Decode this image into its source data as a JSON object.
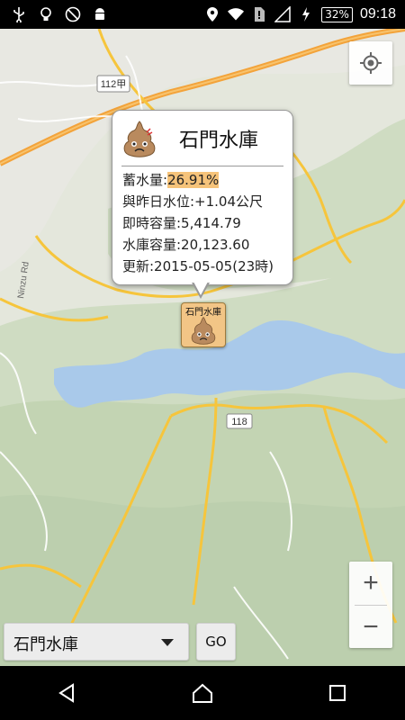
{
  "status_bar": {
    "icons": [
      "usb-icon",
      "lightbulb-icon",
      "no-ads-icon",
      "android-icon",
      "location-icon",
      "wifi-icon",
      "sim-icon",
      "signal-icon",
      "battery-charging-icon"
    ],
    "battery": "32%",
    "time": "09:18"
  },
  "map": {
    "labels": {
      "road_112": "112甲",
      "road_118": "118",
      "ninzu_rd": "Ninzu Rd"
    },
    "colors": {
      "water": "#a9c9ea",
      "land": "#dfe6d2",
      "hills": "#c4d6b4",
      "road_major": "#f6c53c",
      "road_orange": "#f3a33a"
    }
  },
  "info_window": {
    "title": "石門水庫",
    "storage_label": "蓄水量:",
    "storage_value": "26.91%",
    "level_change": "與昨日水位:+1.04公尺",
    "current_capacity": "即時容量:5,414.79",
    "total_capacity": "水庫容量:20,123.60",
    "updated": "更新:2015-05-05(23時)"
  },
  "marker": {
    "label": "石門水庫"
  },
  "controls": {
    "reservoir_select": "石門水庫",
    "go_label": "GO",
    "zoom_in": "+",
    "zoom_out": "−"
  }
}
